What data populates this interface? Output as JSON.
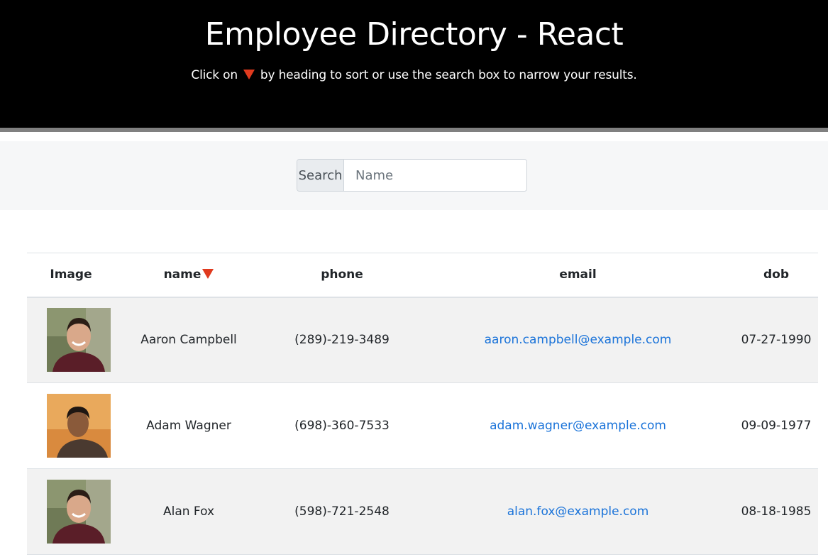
{
  "header": {
    "title": "Employee Directory - React",
    "subtitle_before": "Click on",
    "subtitle_after": "by heading to sort or use the search box to narrow your results.",
    "sort_icon": "sort-down-triangle-icon"
  },
  "search": {
    "label": "Search",
    "placeholder": "Name",
    "value": ""
  },
  "table": {
    "headers": {
      "image": "Image",
      "name": "name",
      "phone": "phone",
      "email": "email",
      "dob": "dob"
    },
    "rows": [
      {
        "name": "Aaron Campbell",
        "phone": "(289)-219-3489",
        "email": "aaron.campbell@example.com",
        "dob": "07-27-1990"
      },
      {
        "name": "Adam Wagner",
        "phone": "(698)-360-7533",
        "email": "adam.wagner@example.com",
        "dob": "09-09-1977"
      },
      {
        "name": "Alan Fox",
        "phone": "(598)-721-2548",
        "email": "alan.fox@example.com",
        "dob": "08-18-1985"
      }
    ]
  },
  "colors": {
    "header_bg": "#000000",
    "accent_triangle": "#e03a1e",
    "link": "#1a73d9",
    "stripe": "#f2f2f2"
  }
}
